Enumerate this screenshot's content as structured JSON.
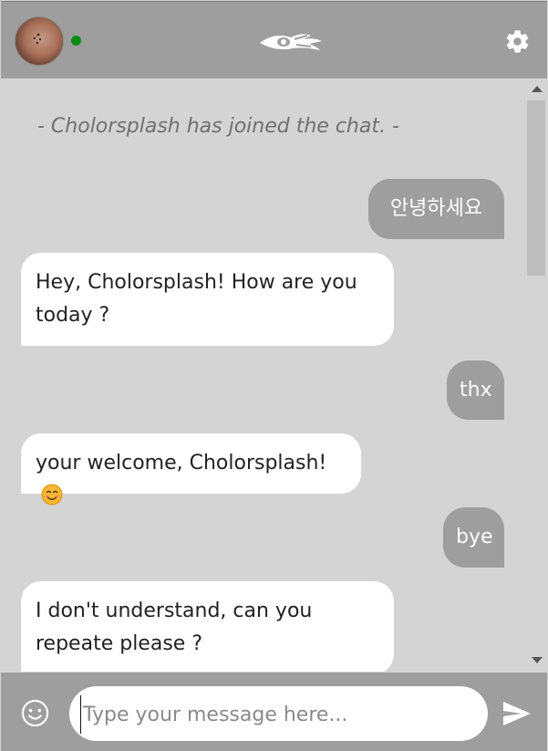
{
  "header": {
    "avatar_icon": "user-avatar",
    "online_status_color": "#0a8a16",
    "logo_icon": "eye-logo-icon",
    "settings_icon": "gear-icon"
  },
  "messages": {
    "system": "- Cholorsplash has joined the chat. -",
    "items": [
      {
        "direction": "out",
        "text": "안녕하세요"
      },
      {
        "direction": "in",
        "text": "Hey, Cholorsplash! How are you today ?"
      },
      {
        "direction": "out",
        "text": "thx"
      },
      {
        "direction": "in",
        "text": "your welcome, Cholorsplash!",
        "emoji": "smiling-face-emoji"
      },
      {
        "direction": "out",
        "text": "bye"
      },
      {
        "direction": "in",
        "text": "I don't understand, can you repeate please ?"
      }
    ]
  },
  "composer": {
    "emoji_icon": "smiley-icon",
    "placeholder": "Type your message here...",
    "value": "",
    "send_icon": "send-icon"
  },
  "colors": {
    "header_bg": "#9e9e9e",
    "chat_bg": "#d4d4d4",
    "outgoing_bubble": "#9e9e9e",
    "incoming_bubble": "#ffffff"
  }
}
